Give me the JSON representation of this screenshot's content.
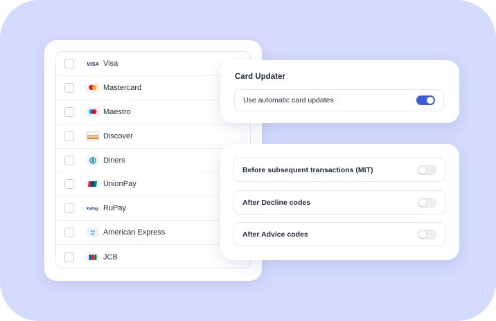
{
  "brands": [
    {
      "label": "Visa",
      "logo": "visa-icon",
      "checked": false
    },
    {
      "label": "Mastercard",
      "logo": "mastercard-icon",
      "checked": false
    },
    {
      "label": "Maestro",
      "logo": "maestro-icon",
      "checked": false
    },
    {
      "label": "Discover",
      "logo": "discover-icon",
      "checked": false
    },
    {
      "label": "Diners",
      "logo": "diners-icon",
      "checked": false
    },
    {
      "label": "UnionPay",
      "logo": "unionpay-icon",
      "checked": false
    },
    {
      "label": "RuPay",
      "logo": "rupay-icon",
      "checked": false
    },
    {
      "label": "American Express",
      "logo": "amex-icon",
      "checked": false
    },
    {
      "label": "JCB",
      "logo": "jcb-icon",
      "checked": false
    }
  ],
  "card_updater": {
    "title": "Card Updater",
    "auto_updates_label": "Use automatic card updates",
    "auto_updates_enabled": true
  },
  "triggers": [
    {
      "label": "Before subsequent transactions (MIT)",
      "enabled": false
    },
    {
      "label": "After Decline codes",
      "enabled": false
    },
    {
      "label": "After Advice codes",
      "enabled": false
    }
  ],
  "colors": {
    "background": "#d4dbfd",
    "accent": "#3b5bdb"
  }
}
